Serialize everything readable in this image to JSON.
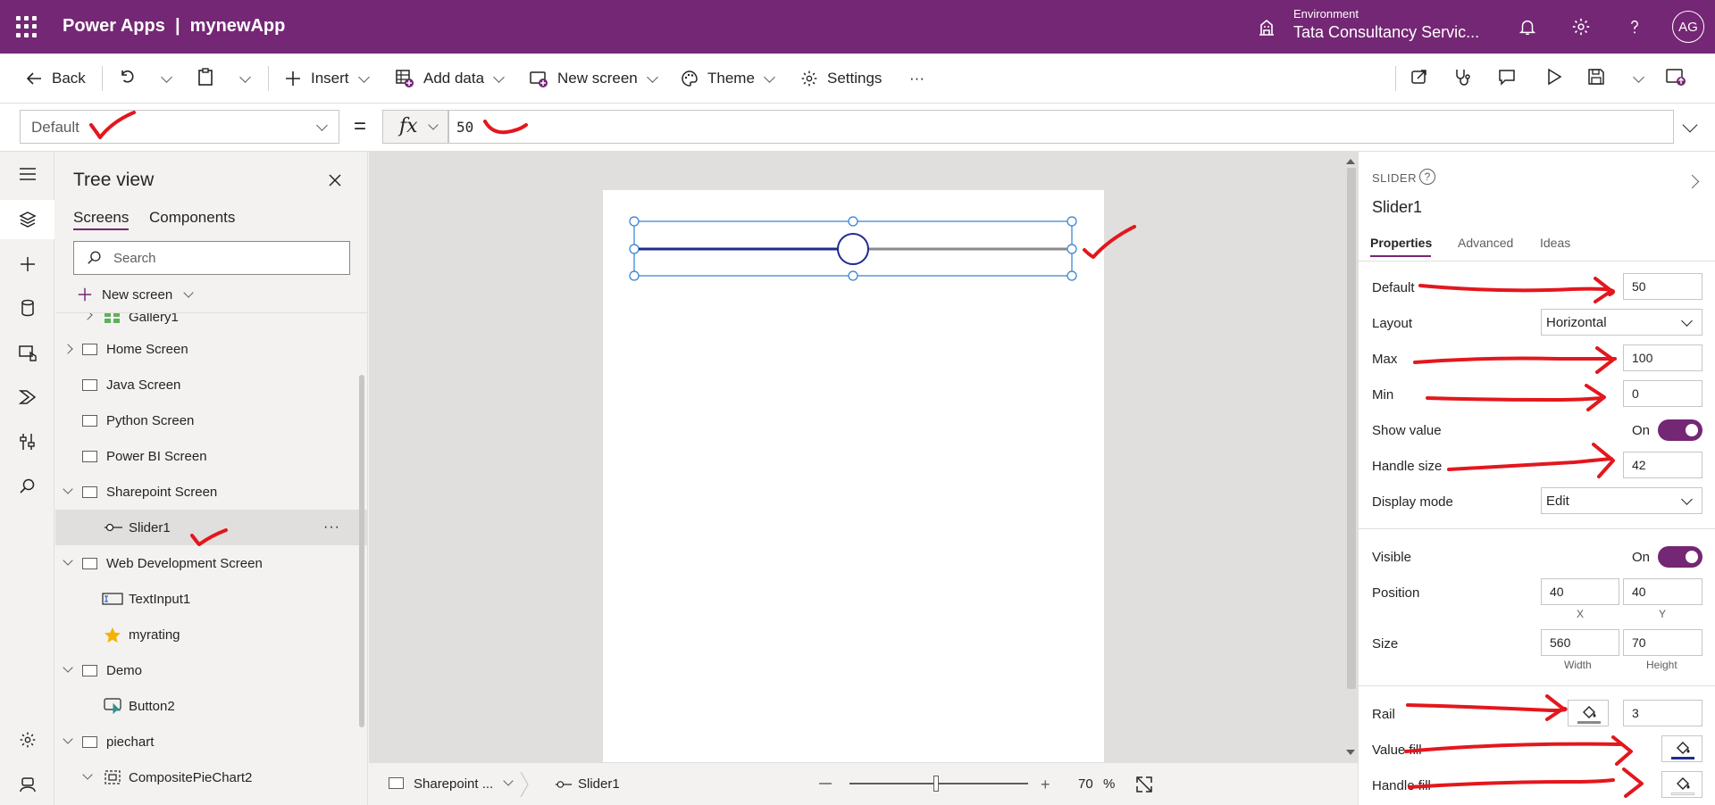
{
  "topbar": {
    "app_title": "Power Apps  |  mynewApp",
    "environment_label": "Environment",
    "environment_value": "Tata Consultancy Servic...",
    "avatar_initials": "AG",
    "accent_color": "#742774"
  },
  "commandbar": {
    "back": "Back",
    "insert": "Insert",
    "add_data": "Add data",
    "new_screen": "New screen",
    "theme": "Theme",
    "settings": "Settings",
    "more": "···"
  },
  "formulabar": {
    "property": "Default",
    "equals": "=",
    "fx": "fx",
    "formula": "50"
  },
  "treeview": {
    "title": "Tree view",
    "tabs": [
      "Screens",
      "Components"
    ],
    "search_placeholder": "Search",
    "new_screen": "New screen",
    "items": [
      {
        "label": "Gallery1"
      },
      {
        "label": "Home Screen"
      },
      {
        "label": "Java Screen"
      },
      {
        "label": "Python Screen"
      },
      {
        "label": "Power BI Screen"
      },
      {
        "label": "Sharepoint Screen"
      },
      {
        "label": "Slider1"
      },
      {
        "label": "Web Development Screen"
      },
      {
        "label": "TextInput1"
      },
      {
        "label": "myrating"
      },
      {
        "label": "Demo"
      },
      {
        "label": "Button2"
      },
      {
        "label": "piechart"
      },
      {
        "label": "CompositePieChart2"
      }
    ],
    "row_more": "···"
  },
  "statusbar": {
    "screen": "Sharepoint ...",
    "control": "Slider1",
    "zoom": "70",
    "zoom_unit": "%"
  },
  "slider": {
    "value_fraction": 0.5,
    "value_color": "#1f2b8e",
    "rail_color": "#8a8a8a"
  },
  "properties": {
    "control_type": "SLIDER",
    "help": "?",
    "control_name": "Slider1",
    "tabs": [
      "Properties",
      "Advanced",
      "Ideas"
    ],
    "default_label": "Default",
    "default_value": "50",
    "layout_label": "Layout",
    "layout_value": "Horizontal",
    "max_label": "Max",
    "max_value": "100",
    "min_label": "Min",
    "min_value": "0",
    "show_value_label": "Show value",
    "show_value_state": "On",
    "handle_size_label": "Handle size",
    "handle_size_value": "42",
    "display_mode_label": "Display mode",
    "display_mode_value": "Edit",
    "visible_label": "Visible",
    "visible_state": "On",
    "position_label": "Position",
    "position_x": "40",
    "position_y": "40",
    "x_caption": "X",
    "y_caption": "Y",
    "size_label": "Size",
    "size_width": "560",
    "size_height": "70",
    "width_caption": "Width",
    "height_caption": "Height",
    "rail_label": "Rail",
    "rail_value": "3",
    "value_fill_label": "Value fill",
    "handle_fill_label": "Handle fill"
  }
}
